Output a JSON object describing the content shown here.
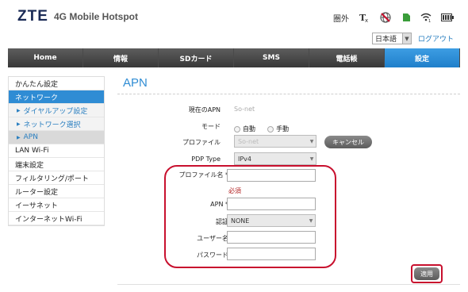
{
  "header": {
    "logo": "ZTE",
    "product": "4G Mobile Hotspot",
    "status_text": "圏外",
    "language": "日本語",
    "logout": "ログアウト"
  },
  "nav": [
    {
      "label": "Home"
    },
    {
      "label": "情報"
    },
    {
      "label": "SDカード"
    },
    {
      "label": "SMS"
    },
    {
      "label": "電話帳"
    },
    {
      "label": "設定"
    }
  ],
  "sidebar": [
    {
      "label": "かんたん設定"
    },
    {
      "label": "ネットワーク"
    },
    {
      "label": "ダイヤルアップ設定"
    },
    {
      "label": "ネットワーク選択"
    },
    {
      "label": "APN"
    },
    {
      "label": "LAN Wi-Fi"
    },
    {
      "label": "端末設定"
    },
    {
      "label": "フィルタリング/ポート"
    },
    {
      "label": "ルーター設定"
    },
    {
      "label": "イーサネット"
    },
    {
      "label": "インターネットWi-Fi"
    }
  ],
  "main": {
    "title": "APN",
    "current_apn_label": "現在のAPN",
    "current_apn_value": "So-net",
    "mode_label": "モード",
    "mode_auto": "自動",
    "mode_manual": "手動",
    "profile_label": "プロファイル",
    "profile_value": "So-net",
    "cancel_button": "キャンセル",
    "pdp_type_label": "PDP Type",
    "pdp_type_value": "IPv4",
    "profile_name_label": "プロファイル名 *",
    "required_note": "必須",
    "apn_label": "APN *",
    "auth_label": "認証",
    "auth_value": "NONE",
    "username_label": "ユーザー名",
    "password_label": "パスワード",
    "apply_button": "適用"
  },
  "colors": {
    "accent": "#2f8cd4",
    "nav_dark": "#383838",
    "highlight": "#c8102e"
  }
}
